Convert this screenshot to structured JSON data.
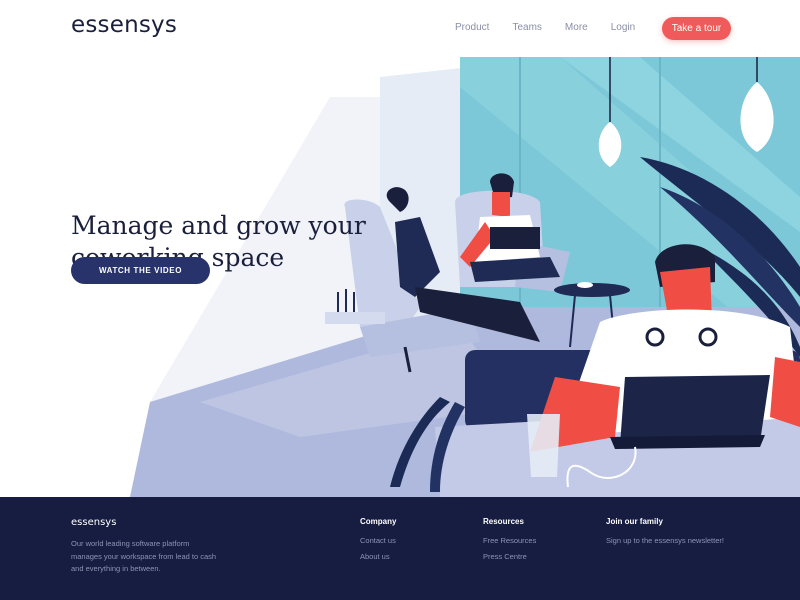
{
  "brand": {
    "logo_text": "essensys"
  },
  "nav": {
    "links": [
      "Product",
      "Teams",
      "More",
      "Login"
    ],
    "cta_label": "Take a tour",
    "cta_color": "#f05a5a"
  },
  "hero": {
    "headline_line1": "Manage and grow your",
    "headline_line2": "coworking space",
    "video_button_label": "WATCH THE VIDEO",
    "button_color": "#27336a",
    "illustration_icon": "coworking-illustration"
  },
  "footer": {
    "logo_text": "essensys",
    "description": "Our world leading software platform manages your workspace from lead to cash and everything in between.",
    "company": {
      "title": "Company",
      "links": [
        "Contact us",
        "About us"
      ]
    },
    "resources": {
      "title": "Resources",
      "links": [
        "Free Resources",
        "Press Centre"
      ]
    },
    "join": {
      "title": "Join our family",
      "text": "Sign up to the essensys newsletter!"
    },
    "background_color": "#161d41"
  }
}
